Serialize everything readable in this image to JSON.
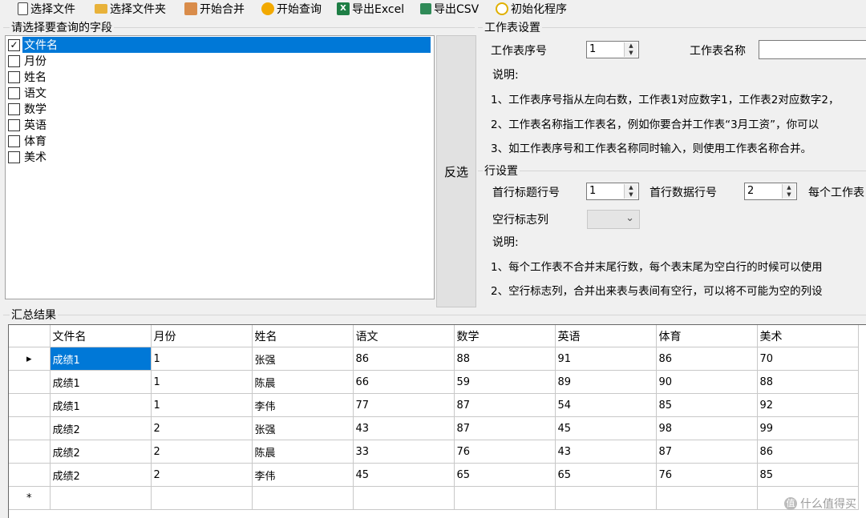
{
  "toolbar": {
    "select_file": "选择文件",
    "select_folder": "选择文件夹",
    "start_merge": "开始合并",
    "start_query": "开始查询",
    "export_excel": "导出Excel",
    "export_csv": "导出CSV",
    "init_program": "初始化程序"
  },
  "fields_group": {
    "title": "请选择要查询的字段",
    "items": [
      {
        "label": "文件名",
        "checked": true,
        "selected": true
      },
      {
        "label": "月份",
        "checked": false
      },
      {
        "label": "姓名",
        "checked": false
      },
      {
        "label": "语文",
        "checked": false
      },
      {
        "label": "数学",
        "checked": false
      },
      {
        "label": "英语",
        "checked": false
      },
      {
        "label": "体育",
        "checked": false
      },
      {
        "label": "美术",
        "checked": false
      }
    ],
    "invert_label": "反选"
  },
  "sheet_settings": {
    "title": "工作表设置",
    "index_label": "工作表序号",
    "index_value": "1",
    "name_label": "工作表名称",
    "name_value": "",
    "note_label": "说明:",
    "notes": [
      "1、工作表序号指从左向右数，工作表1对应数字1，工作表2对应数字2，",
      "2、工作表名称指工作表名，例如你要合并工作表“3月工资”，你可以",
      "3、如工作表序号和工作表名称同时输入，则使用工作表名称合并。"
    ]
  },
  "row_settings": {
    "title": "行设置",
    "header_row_label": "首行标题行号",
    "header_row_value": "1",
    "data_row_label": "首行数据行号",
    "data_row_value": "2",
    "per_sheet_label": "每个工作表",
    "blank_col_label": "空行标志列",
    "blank_col_value": "",
    "note_label": "说明:",
    "notes": [
      "1、每个工作表不合并末尾行数，每个表末尾为空白行的时候可以使用",
      "2、空行标志列，合并出来表与表间有空行，可以将不可能为空的列设"
    ]
  },
  "results": {
    "title": "汇总结果",
    "columns": [
      "文件名",
      "月份",
      "姓名",
      "语文",
      "数学",
      "英语",
      "体育",
      "美术"
    ],
    "rows": [
      [
        "成绩1",
        "1",
        "张强",
        "86",
        "88",
        "91",
        "86",
        "70"
      ],
      [
        "成绩1",
        "1",
        "陈晨",
        "66",
        "59",
        "89",
        "90",
        "88"
      ],
      [
        "成绩1",
        "1",
        "李伟",
        "77",
        "87",
        "54",
        "85",
        "92"
      ],
      [
        "成绩2",
        "2",
        "张强",
        "43",
        "87",
        "45",
        "98",
        "99"
      ],
      [
        "成绩2",
        "2",
        "陈晨",
        "33",
        "76",
        "43",
        "87",
        "86"
      ],
      [
        "成绩2",
        "2",
        "李伟",
        "45",
        "65",
        "65",
        "76",
        "85"
      ]
    ],
    "current_row_marker": "▸",
    "new_row_marker": "*"
  },
  "watermark": {
    "text": "什么值得买",
    "icon": "值"
  },
  "icons": {
    "select_file": "file-icon",
    "select_folder": "folder-icon",
    "start_merge": "merge-icon",
    "start_query": "query-icon",
    "export_excel": "excel-icon",
    "export_csv": "csv-icon",
    "init_program": "refresh-icon"
  }
}
